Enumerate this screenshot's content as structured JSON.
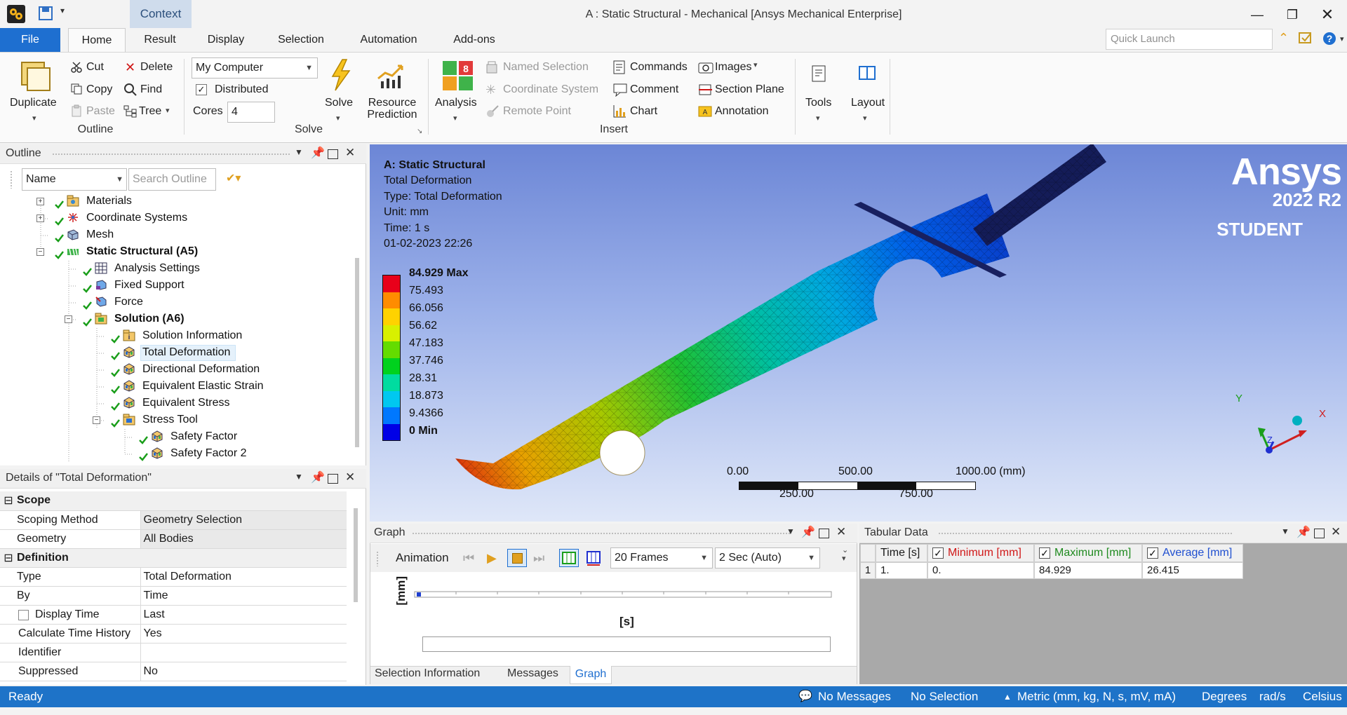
{
  "window": {
    "title": "A : Static Structural - Mechanical [Ansys Mechanical Enterprise]",
    "context_tab": "Context"
  },
  "tabs": [
    "File",
    "Home",
    "Result",
    "Display",
    "Selection",
    "Automation",
    "Add-ons"
  ],
  "quick_launch": {
    "placeholder": "Quick Launch"
  },
  "ribbon": {
    "outline": {
      "label": "Outline",
      "duplicate": "Duplicate",
      "cut": "Cut",
      "copy": "Copy",
      "paste": "Paste",
      "delete": "Delete",
      "find": "Find",
      "tree": "Tree"
    },
    "solve": {
      "label": "Solve",
      "machine": "My Computer",
      "distributed": "Distributed",
      "cores_label": "Cores",
      "cores_value": "4",
      "solve": "Solve",
      "resource_line1": "Resource",
      "resource_line2": "Prediction"
    },
    "insert": {
      "label": "Insert",
      "analysis": "Analysis",
      "named_selection": "Named Selection",
      "coordinate_system": "Coordinate System",
      "remote_point": "Remote Point",
      "commands": "Commands",
      "comment": "Comment",
      "chart": "Chart",
      "images": "Images",
      "section_plane": "Section Plane",
      "annotation": "Annotation"
    },
    "tools": "Tools",
    "layout": "Layout"
  },
  "outline": {
    "title": "Outline",
    "filter": "Name",
    "search_placeholder": "Search Outline",
    "items": [
      {
        "label": "Materials"
      },
      {
        "label": "Coordinate Systems"
      },
      {
        "label": "Mesh"
      },
      {
        "label": "Static Structural (A5)"
      },
      {
        "label": "Analysis Settings"
      },
      {
        "label": "Fixed Support"
      },
      {
        "label": "Force"
      },
      {
        "label": "Solution (A6)"
      },
      {
        "label": "Solution Information"
      },
      {
        "label": "Total Deformation"
      },
      {
        "label": "Directional Deformation"
      },
      {
        "label": "Equivalent Elastic Strain"
      },
      {
        "label": "Equivalent Stress"
      },
      {
        "label": "Stress Tool"
      },
      {
        "label": "Safety Factor"
      },
      {
        "label": "Safety Factor 2"
      }
    ]
  },
  "details": {
    "title": "Details of \"Total Deformation\"",
    "scope_header": "Scope",
    "scoping_method": {
      "label": "Scoping Method",
      "value": "Geometry Selection"
    },
    "geometry": {
      "label": "Geometry",
      "value": "All Bodies"
    },
    "definition_header": "Definition",
    "type": {
      "label": "Type",
      "value": "Total Deformation"
    },
    "by": {
      "label": "By",
      "value": "Time"
    },
    "display_time": {
      "label": "Display Time",
      "value": "Last"
    },
    "calc_time_history": {
      "label": "Calculate Time History",
      "value": "Yes"
    },
    "identifier": {
      "label": "Identifier",
      "value": ""
    },
    "suppressed": {
      "label": "Suppressed",
      "value": "No"
    }
  },
  "viewport": {
    "info": [
      "A: Static Structural",
      "Total Deformation",
      "Type: Total Deformation",
      "Unit: mm",
      "Time: 1 s",
      "01-02-2023 22:26"
    ],
    "legend": [
      "84.929 Max",
      "75.493",
      "66.056",
      "56.62",
      "47.183",
      "37.746",
      "28.31",
      "18.873",
      "9.4366",
      "0 Min"
    ],
    "legend_colors": [
      "#e8001a",
      "#ff8c00",
      "#ffd200",
      "#d8f000",
      "#64dc00",
      "#00d21e",
      "#00dca0",
      "#00c8f0",
      "#0078ff",
      "#0000e6"
    ],
    "scale_top": [
      "0.00",
      "500.00",
      "1000.00 (mm)"
    ],
    "scale_bottom": [
      "250.00",
      "750.00"
    ],
    "brand": "Ansys",
    "version": "2022 R2",
    "edition": "STUDENT",
    "axes": {
      "x": "X",
      "y": "Y",
      "z": "Z"
    }
  },
  "graph": {
    "title": "Graph",
    "animation": "Animation",
    "frames": "20 Frames",
    "duration": "2 Sec (Auto)",
    "y_unit": "[mm]",
    "x_unit": "[s]",
    "tabs": [
      "Selection Information",
      "Messages",
      "Graph"
    ]
  },
  "tabular": {
    "title": "Tabular Data",
    "columns": [
      "Time [s]",
      "Minimum [mm]",
      "Maximum [mm]",
      "Average [mm]"
    ],
    "column_colors": [
      "#222222",
      "#d01818",
      "#1f8a1f",
      "#1f4fd0"
    ],
    "rows": [
      {
        "index": "1",
        "time": "1.",
        "min": "0.",
        "max": "84.929",
        "avg": "26.415"
      }
    ]
  },
  "status": {
    "ready": "Ready",
    "messages": "No Messages",
    "selection": "No Selection",
    "units": "Metric (mm, kg, N, s, mV, mA)",
    "angle": "Degrees",
    "rate": "rad/s",
    "temp": "Celsius"
  }
}
